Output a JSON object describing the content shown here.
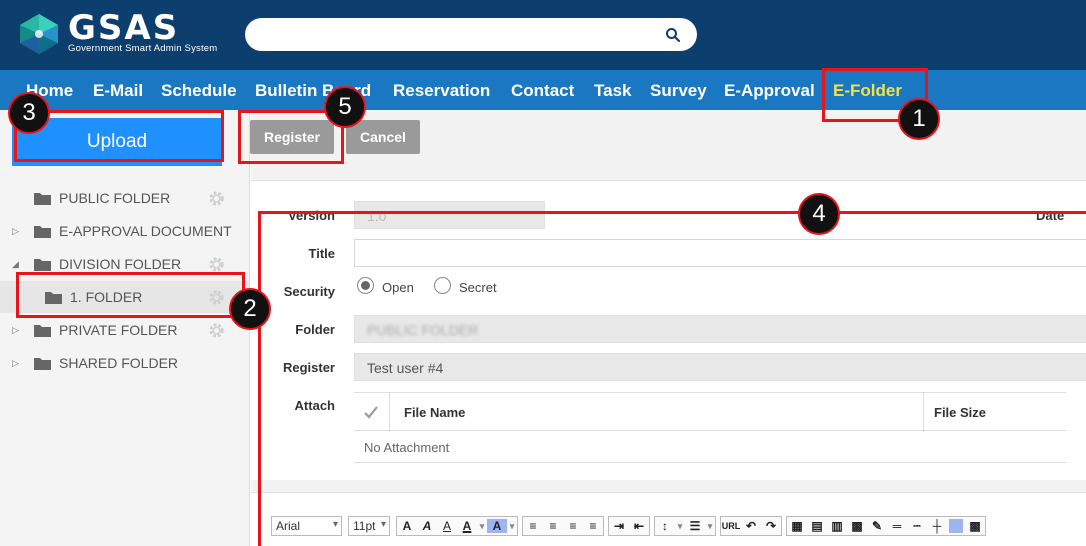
{
  "app": {
    "logo_title": "GSAS",
    "logo_subtitle": "Government Smart Admin System"
  },
  "search": {
    "placeholder": ""
  },
  "nav": {
    "items": [
      "Home",
      "E-Mail",
      "Schedule",
      "Bulletin Board",
      "Reservation",
      "Contact",
      "Task",
      "Survey",
      "E-Approval",
      "E-Folder"
    ],
    "active": "E-Folder"
  },
  "sidebar": {
    "upload_label": "Upload",
    "folders": [
      {
        "label": "PUBLIC FOLDER",
        "expandable": false,
        "expanded": false,
        "selected": false,
        "has_settings": true
      },
      {
        "label": "E-APPROVAL DOCUMENT",
        "expandable": true,
        "expanded": false,
        "selected": false,
        "has_settings": false
      },
      {
        "label": "DIVISION FOLDER",
        "expandable": true,
        "expanded": true,
        "selected": false,
        "has_settings": true
      },
      {
        "label": "1. FOLDER",
        "expandable": false,
        "expanded": false,
        "selected": true,
        "has_settings": true
      },
      {
        "label": "PRIVATE FOLDER",
        "expandable": true,
        "expanded": false,
        "selected": false,
        "has_settings": true
      },
      {
        "label": "SHARED FOLDER",
        "expandable": true,
        "expanded": false,
        "selected": false,
        "has_settings": false
      }
    ]
  },
  "actions": {
    "register_label": "Register",
    "cancel_label": "Cancel"
  },
  "form": {
    "version_label": "Version",
    "version_value": "1.0",
    "date_label": "Date",
    "title_label": "Title",
    "title_value": "",
    "security_label": "Security",
    "security_options": [
      "Open",
      "Secret"
    ],
    "security_selected": "Open",
    "folder_label": "Folder",
    "folder_value": "PUBLIC FOLDER",
    "register_label": "Register",
    "register_value": "Test user #4",
    "attach_label": "Attach",
    "attach_columns": [
      "File Name",
      "File Size"
    ],
    "attach_empty": "No Attachment"
  },
  "editor": {
    "font_family": "Arial",
    "font_size": "11pt",
    "url_button": "URL"
  },
  "annotations": {
    "colors": {
      "highlight": "#e8141c",
      "badge_bg": "#111111"
    },
    "badges": [
      "1",
      "2",
      "3",
      "4",
      "5"
    ]
  },
  "colors": {
    "header_bg": "#0d3f6e",
    "nav_bg": "#1a78c2",
    "nav_active": "#f5e04a",
    "upload_bg": "#1e90ff",
    "gray_button": "#9a9a9a"
  }
}
